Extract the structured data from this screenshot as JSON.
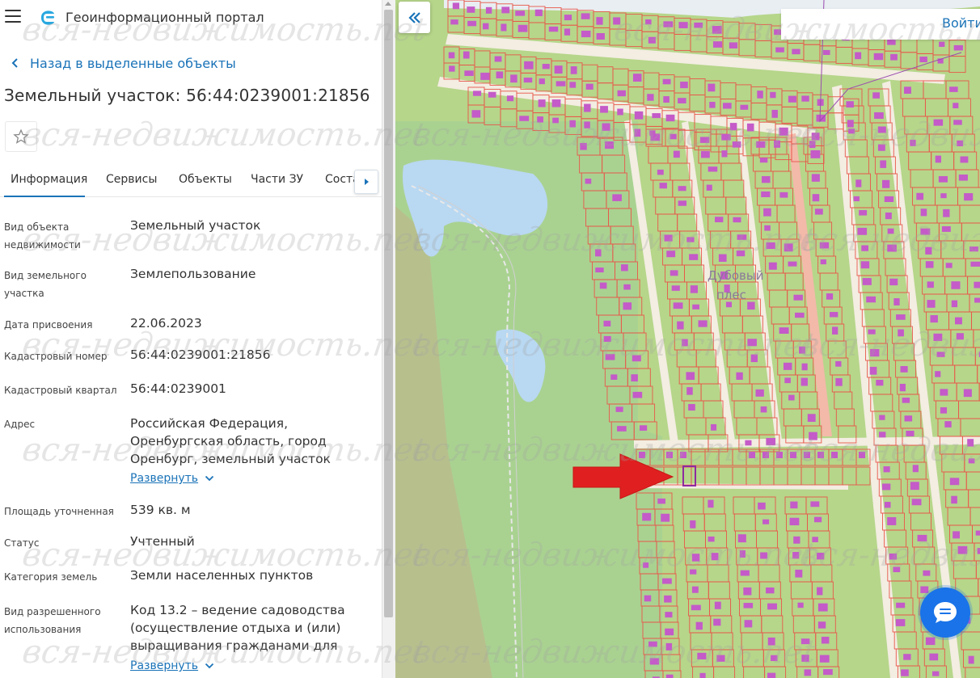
{
  "header": {
    "title": "Геоинформационный портал"
  },
  "nav": {
    "back_label": "Назад в выделенные объекты"
  },
  "object": {
    "title": "Земельный участок: 56:44:0239001:21856"
  },
  "tabs": [
    {
      "label": "Информация"
    },
    {
      "label": "Сервисы"
    },
    {
      "label": "Объекты"
    },
    {
      "label": "Части ЗУ"
    },
    {
      "label": "Соста"
    }
  ],
  "fields": [
    {
      "label": "Вид объекта недвижимости",
      "value": "Земельный участок"
    },
    {
      "label": "Вид земельного участка",
      "value": "Землепользование"
    },
    {
      "label": "Дата присвоения",
      "value": "22.06.2023"
    },
    {
      "label": "Кадастровый номер",
      "value": "56:44:0239001:21856"
    },
    {
      "label": "Кадастровый квартал",
      "value": "56:44:0239001"
    },
    {
      "label": "Адрес",
      "value": "Российская Федерация, Оренбургская область, город Оренбург, земельный участок"
    },
    {
      "label": "Площадь уточненная",
      "value": "539 кв. м"
    },
    {
      "label": "Статус",
      "value": "Учтенный"
    },
    {
      "label": "Категория земель",
      "value": "Земли населенных пунктов"
    },
    {
      "label": "Вид разрешенного использования",
      "value": "Код 13.2 – ведение садоводства (осуществление отдыха и (или) выращивания гражданами для"
    }
  ],
  "expand_label": "Развернуть",
  "map": {
    "login_label": "Войти",
    "place_label_1": "Дубовый",
    "place_label_2": "плес"
  },
  "watermark": "вся-недвижимость.net",
  "colors": {
    "accent": "#1a73b8",
    "parcel_border": "#e8574a",
    "building": "#c45bc8",
    "map_green": "#b6d68a",
    "water": "#b9d8f2",
    "arrow": "#e02020"
  },
  "icons": {
    "menu": "hamburger-icon",
    "logo": "portal-logo-icon",
    "back": "chevron-left-icon",
    "favorite": "star-icon",
    "tabs_next": "caret-right-icon",
    "collapse": "double-chevron-left-icon",
    "chat": "chat-icon"
  }
}
